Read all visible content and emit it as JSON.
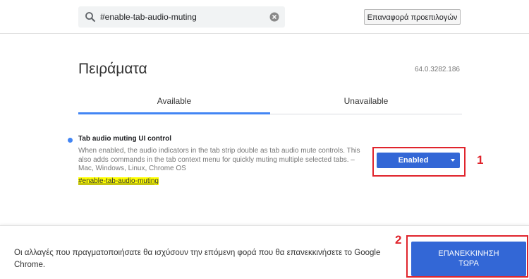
{
  "search": {
    "value": "#enable-tab-audio-muting",
    "icon": "search-icon",
    "clear_icon": "clear-icon"
  },
  "reset_button": {
    "label": "Επαναφορά προεπιλογών"
  },
  "page": {
    "title": "Πειράματα",
    "version": "64.0.3282.186"
  },
  "tabs": [
    {
      "label": "Available",
      "selected": true
    },
    {
      "label": "Unavailable",
      "selected": false
    }
  ],
  "experiment": {
    "title": "Tab audio muting UI control",
    "description": "When enabled, the audio indicators in the tab strip double as tab audio mute controls. This also adds commands in the tab context menu for quickly muting multiple selected tabs. – Mac, Windows, Linux, Chrome OS",
    "link": "#enable-tab-audio-muting",
    "select_value": "Enabled"
  },
  "annotations": {
    "first": "1",
    "second": "2"
  },
  "footer": {
    "notice": "Οι αλλαγές που πραγματοποιήσατε θα ισχύσουν την επόμενη φορά που θα επανεκκινήσετε το Google Chrome.",
    "relaunch_line1": "ΕΠΑΝΕΚΚΙΝΗΣΗ",
    "relaunch_line2": "ΤΩΡΑ"
  },
  "colors": {
    "accent": "#4285f4",
    "button": "#3367d6",
    "annotation": "#e0242c",
    "highlight": "#ffff00"
  }
}
